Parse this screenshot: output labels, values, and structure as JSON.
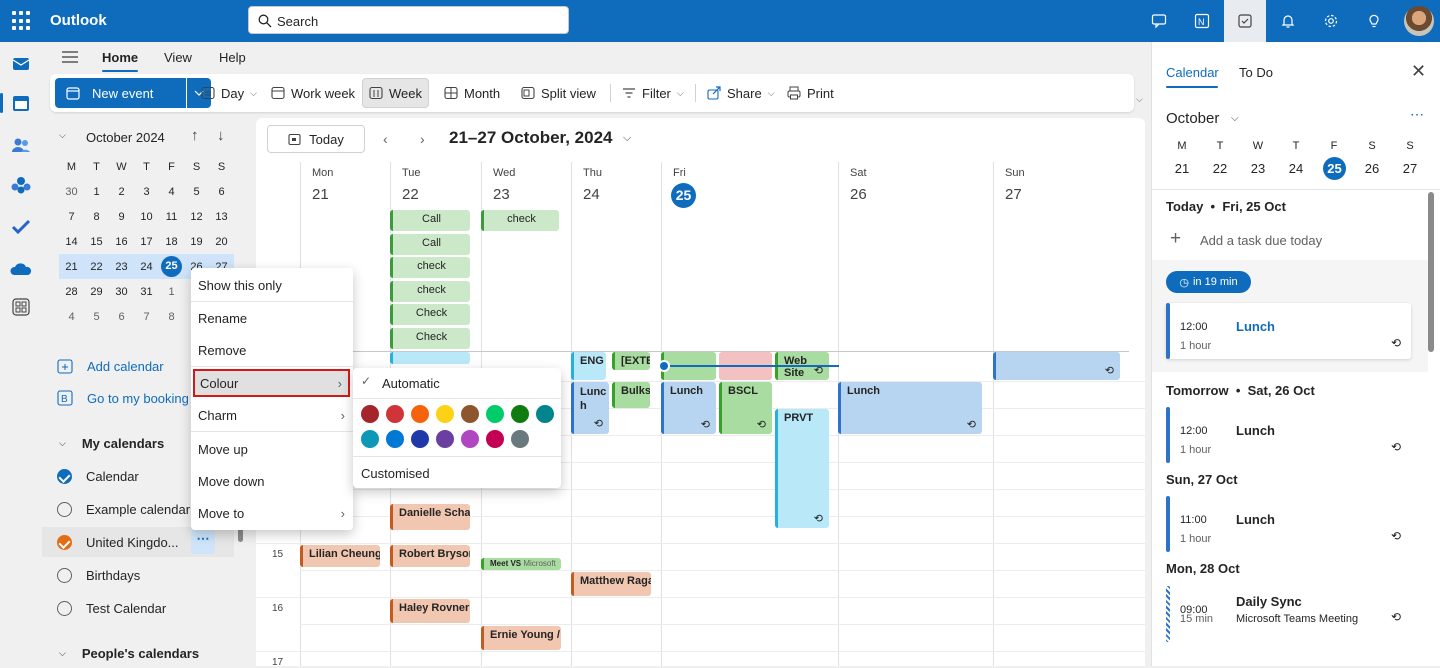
{
  "app": {
    "title": "Outlook"
  },
  "search": {
    "placeholder": "Search"
  },
  "ribbon_tabs": [
    "Home",
    "View",
    "Help"
  ],
  "ribbon": {
    "new_event": "New event",
    "day": "Day",
    "work_week": "Work week",
    "week": "Week",
    "month": "Month",
    "split_view": "Split view",
    "filter": "Filter",
    "share": "Share",
    "print": "Print"
  },
  "mini_calendar": {
    "month_label": "October 2024",
    "weekdays": [
      "M",
      "T",
      "W",
      "T",
      "F",
      "S",
      "S"
    ],
    "weeks": [
      [
        "30",
        "1",
        "2",
        "3",
        "4",
        "5",
        "6"
      ],
      [
        "7",
        "8",
        "9",
        "10",
        "11",
        "12",
        "13"
      ],
      [
        "14",
        "15",
        "16",
        "17",
        "18",
        "19",
        "20"
      ],
      [
        "21",
        "22",
        "23",
        "24",
        "25",
        "26",
        "27"
      ],
      [
        "28",
        "29",
        "30",
        "31",
        "1",
        "2",
        "3"
      ],
      [
        "4",
        "5",
        "6",
        "7",
        "8",
        "9",
        "10"
      ]
    ],
    "today": "25"
  },
  "left_pane": {
    "add_calendar": "Add calendar",
    "go_to_booking": "Go to my booking",
    "my_calendars": "My calendars",
    "calendars": [
      "Calendar",
      "Example calendar",
      "United Kingdo...",
      "Birthdays",
      "Test Calendar"
    ],
    "peoples_calendars": "People's calendars"
  },
  "main": {
    "today_button": "Today",
    "range_label": "21–27 October, 2024",
    "days": [
      {
        "name": "Mon",
        "num": "21"
      },
      {
        "name": "Tue",
        "num": "22"
      },
      {
        "name": "Wed",
        "num": "23"
      },
      {
        "name": "Thu",
        "num": "24"
      },
      {
        "name": "Fri",
        "num": "25"
      },
      {
        "name": "Sat",
        "num": "26"
      },
      {
        "name": "Sun",
        "num": "27"
      }
    ],
    "hours": [
      "15",
      "16",
      "17"
    ],
    "allday_events": {
      "tue": [
        "Call",
        "Call",
        "check",
        "check",
        "Check",
        "Check"
      ],
      "wed": [
        "check"
      ]
    },
    "events": {
      "thu_eng": "ENG",
      "thu_ext": "[EXTE",
      "thu_lunch": "Lunc h",
      "thu_bulk": "Bulks",
      "fri_lunch": "Lunch",
      "fri_bscl": "BSCL",
      "fri_web": "Web Site",
      "fri_prvt": "PRVT",
      "sat_lunch": "Lunch",
      "tue_danielle": "Danielle Schaefer",
      "mon_lilian": "Lilian Cheung",
      "tue_robert": "Robert Bryson",
      "wed_meet": "Meet VS",
      "wed_meet_sub": "Microsoft",
      "thu_matthew": "Matthew Ragan",
      "tue_haley": "Haley Rovner",
      "wed_ernie": "Ernie Young /"
    }
  },
  "context_menu": {
    "items": [
      "Show this only",
      "Rename",
      "Remove",
      "Colour",
      "Charm",
      "Move up",
      "Move down",
      "Move to"
    ]
  },
  "colour_submenu": {
    "automatic": "Automatic",
    "customised": "Customised",
    "swatches": [
      "#a4262c",
      "#d13438",
      "#f7630c",
      "#fcd116",
      "#8e562e",
      "#00cc6a",
      "#107c10",
      "#00848d",
      "#0e98b8",
      "#0078d4",
      "#1f3aa8",
      "#6b3fa0",
      "#b146c2",
      "#c30052",
      "#69797e"
    ]
  },
  "right_pane": {
    "tabs": [
      "Calendar",
      "To Do"
    ],
    "month": "October",
    "weekdays": [
      "M",
      "T",
      "W",
      "T",
      "F",
      "S",
      "S"
    ],
    "days": [
      "21",
      "22",
      "23",
      "24",
      "25",
      "26",
      "27"
    ],
    "today_label": "Today",
    "today_date": "Fri, 25 Oct",
    "add_task": "Add a task due today",
    "in_badge": "in 19 min",
    "tomorrow_label": "Tomorrow",
    "tomorrow_date": "Sat, 26 Oct",
    "sun_label": "Sun, 27 Oct",
    "mon_label": "Mon, 28 Oct",
    "items": [
      {
        "time": "12:00",
        "dur": "1 hour",
        "name": "Lunch"
      },
      {
        "time": "12:00",
        "dur": "1 hour",
        "name": "Lunch"
      },
      {
        "time": "11:00",
        "dur": "1 hour",
        "name": "Lunch"
      },
      {
        "time": "09:00",
        "dur": "15 min",
        "name": "Daily Sync",
        "sub": "Microsoft Teams Meeting"
      }
    ]
  }
}
